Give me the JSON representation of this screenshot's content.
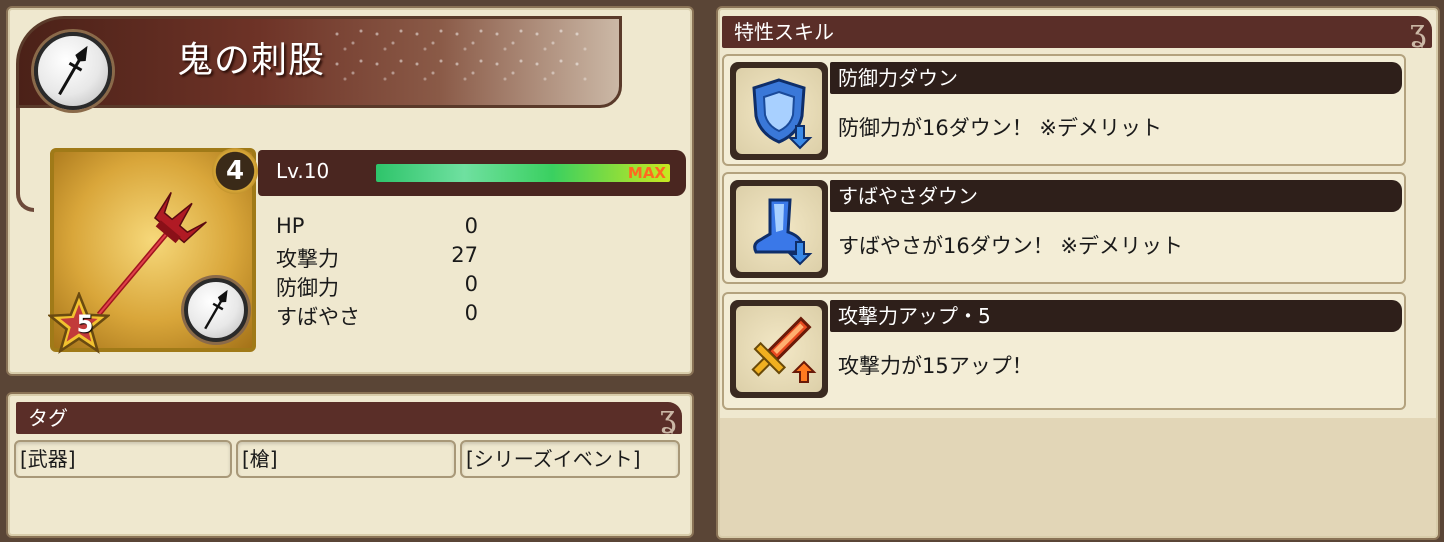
{
  "item": {
    "name": "鬼の刺股",
    "type_icon": "spear-icon",
    "card": {
      "rarity_badge": "4",
      "stars": "5",
      "weapon_icon": "spear-icon"
    },
    "level": {
      "label": "Lv.10",
      "exp_fraction": 1.0,
      "max_label": "MAX"
    },
    "stats": [
      {
        "name": "HP",
        "value": "0"
      },
      {
        "name": "攻撃力",
        "value": "27"
      },
      {
        "name": "防御力",
        "value": "0"
      },
      {
        "name": "すばやさ",
        "value": "0"
      }
    ]
  },
  "tags": {
    "header": "タグ",
    "items": [
      "[武器]",
      "[槍]",
      "[シリーズイベント]"
    ]
  },
  "skills": {
    "header": "特性スキル",
    "items": [
      {
        "name": "防御力ダウン",
        "description": "防御力が16ダウン！ ※デメリット",
        "icon": "shield-down-icon"
      },
      {
        "name": "すばやさダウン",
        "description": "すばやさが16ダウン！ ※デメリット",
        "icon": "boot-down-icon"
      },
      {
        "name": "攻撃力アップ・5",
        "description": "攻撃力が15アップ！",
        "icon": "sword-up-icon"
      }
    ]
  },
  "colors": {
    "panel_bg": "#efe8cf",
    "header_bg": "#5a2e28",
    "skill_name_bg": "#2e1f1a",
    "max_color": "#ff6a20"
  }
}
